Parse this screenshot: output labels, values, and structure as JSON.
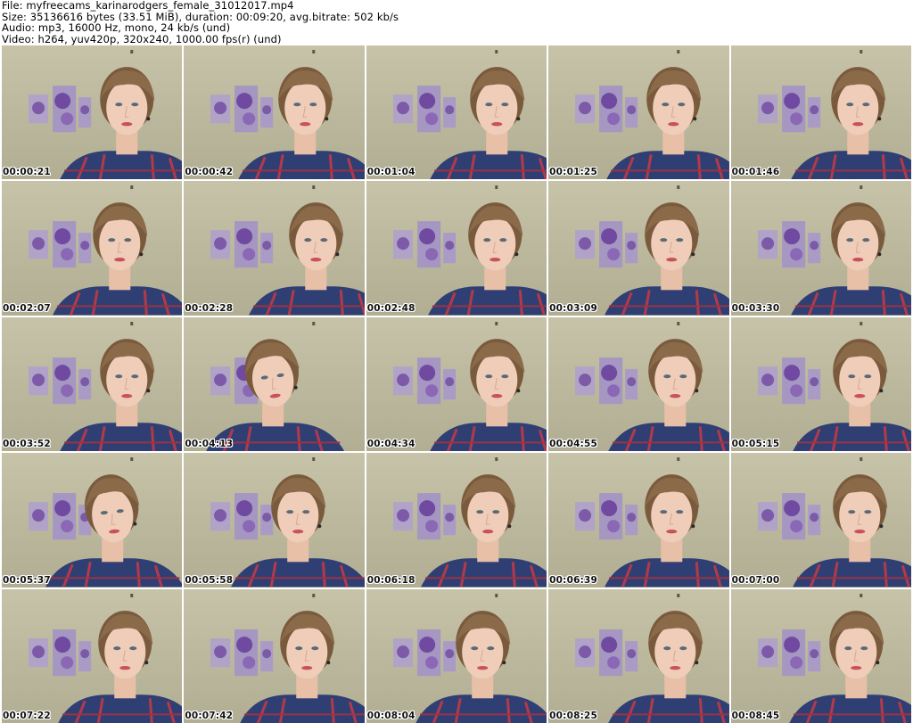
{
  "file_info": {
    "file": "File: myfreecams_karinarodgers_female_31012017.mp4",
    "size": "Size: 35136616 bytes (33.51 MiB), duration: 00:09:20, avg.bitrate: 502 kb/s",
    "audio": "Audio: mp3, 16000 Hz, mono, 24 kb/s (und)",
    "video": "Video: h264, yuv420p, 320x240, 1000.00 fps(r) (und)"
  },
  "frames": [
    {
      "time": "00:00:21"
    },
    {
      "time": "00:00:42"
    },
    {
      "time": "00:01:04"
    },
    {
      "time": "00:01:25"
    },
    {
      "time": "00:01:46"
    },
    {
      "time": "00:02:07"
    },
    {
      "time": "00:02:28"
    },
    {
      "time": "00:02:48"
    },
    {
      "time": "00:03:09"
    },
    {
      "time": "00:03:30"
    },
    {
      "time": "00:03:52"
    },
    {
      "time": "00:04:13"
    },
    {
      "time": "00:04:34"
    },
    {
      "time": "00:04:55"
    },
    {
      "time": "00:05:15"
    },
    {
      "time": "00:05:37"
    },
    {
      "time": "00:05:58"
    },
    {
      "time": "00:06:18"
    },
    {
      "time": "00:06:39"
    },
    {
      "time": "00:07:00"
    },
    {
      "time": "00:07:22"
    },
    {
      "time": "00:07:42"
    },
    {
      "time": "00:08:04"
    },
    {
      "time": "00:08:25"
    },
    {
      "time": "00:08:45"
    }
  ]
}
